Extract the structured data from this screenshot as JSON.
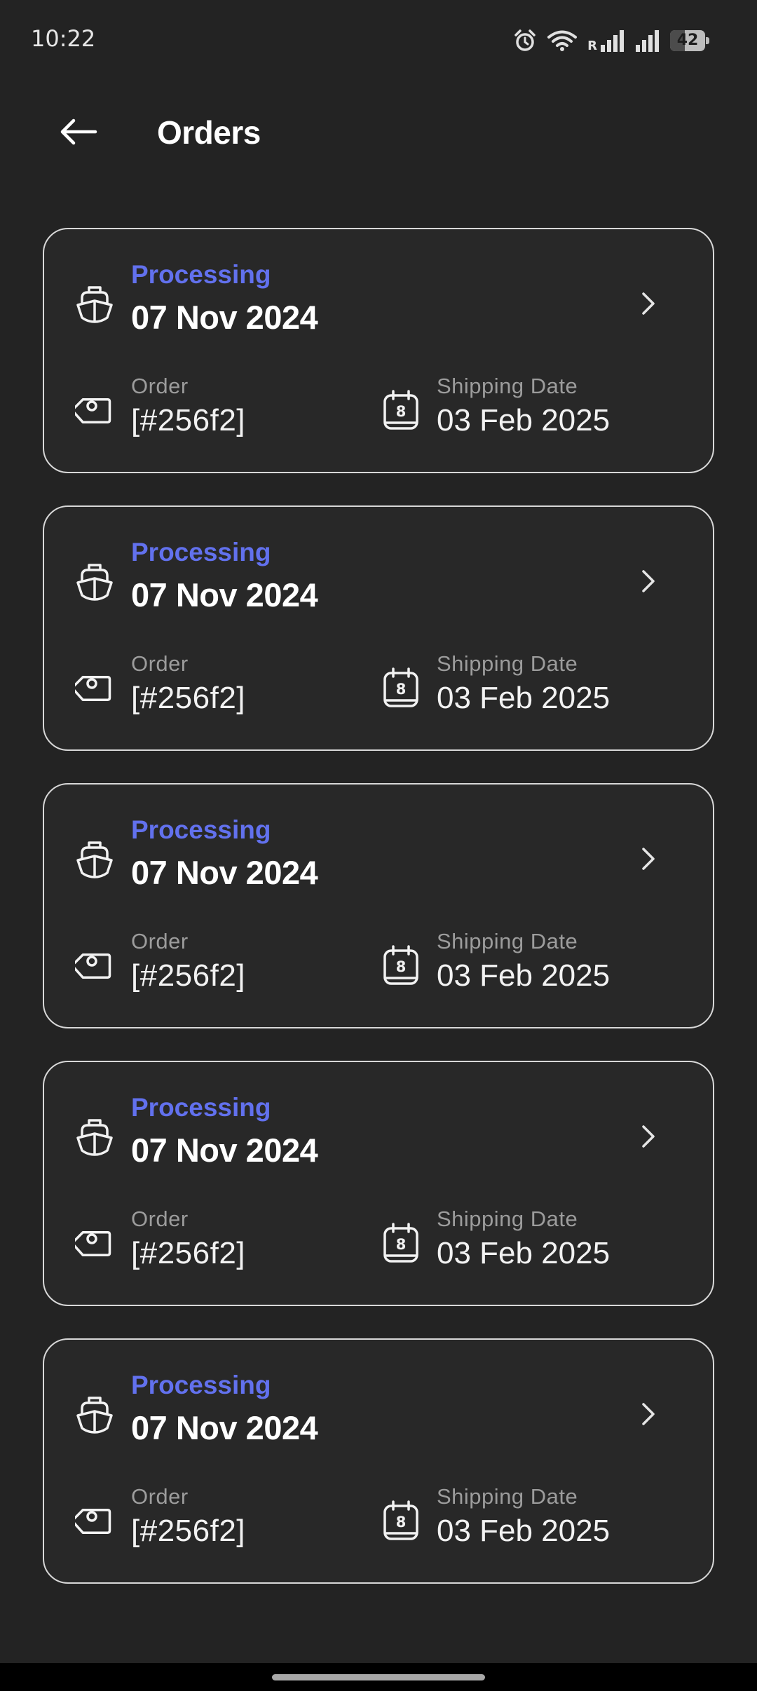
{
  "status_bar": {
    "time": "10:22",
    "battery_level": 42,
    "battery_label": "42",
    "roaming_label": "R",
    "icons": [
      "alarm-icon",
      "wifi-icon",
      "signal-icon",
      "signal-icon"
    ]
  },
  "header": {
    "title": "Orders",
    "back_icon": "arrow-left-icon"
  },
  "orders": [
    {
      "status": "Processing",
      "date": "07 Nov 2024",
      "order_label": "Order",
      "order_id": "[#256f2]",
      "shipping_label": "Shipping Date",
      "shipping_date": "03 Feb 2025",
      "calendar_day": "8"
    },
    {
      "status": "Processing",
      "date": "07 Nov 2024",
      "order_label": "Order",
      "order_id": "[#256f2]",
      "shipping_label": "Shipping Date",
      "shipping_date": "03 Feb 2025",
      "calendar_day": "8"
    },
    {
      "status": "Processing",
      "date": "07 Nov 2024",
      "order_label": "Order",
      "order_id": "[#256f2]",
      "shipping_label": "Shipping Date",
      "shipping_date": "03 Feb 2025",
      "calendar_day": "8"
    },
    {
      "status": "Processing",
      "date": "07 Nov 2024",
      "order_label": "Order",
      "order_id": "[#256f2]",
      "shipping_label": "Shipping Date",
      "shipping_date": "03 Feb 2025",
      "calendar_day": "8"
    },
    {
      "status": "Processing",
      "date": "07 Nov 2024",
      "order_label": "Order",
      "order_id": "[#256f2]",
      "shipping_label": "Shipping Date",
      "shipping_date": "03 Feb 2025",
      "calendar_day": "8"
    }
  ],
  "colors": {
    "background": "#232323",
    "card_border": "#d8d8d8",
    "status_accent": "#6271ee",
    "muted_text": "#9c9c9c"
  }
}
